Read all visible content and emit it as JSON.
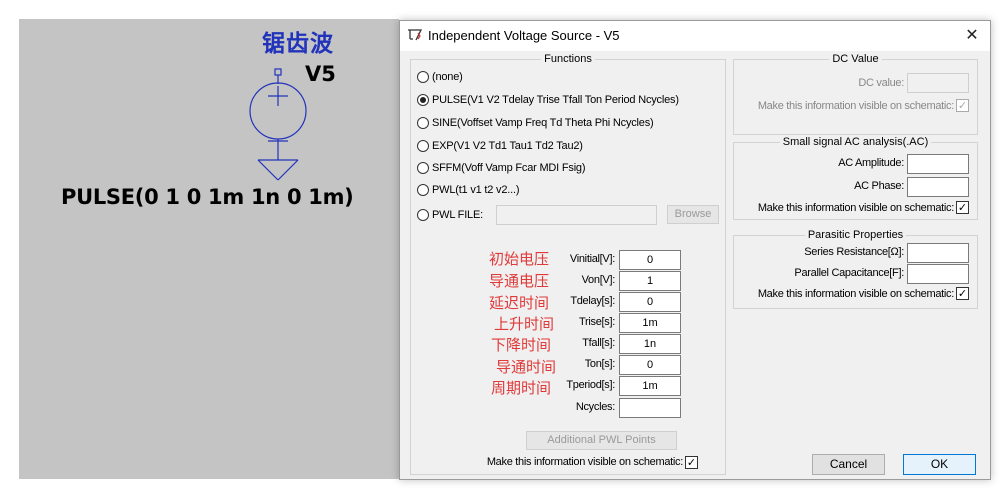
{
  "schematic": {
    "title": "锯齿波",
    "part_name": "V5",
    "source_value": "PULSE(0 1 0 1m 1n 0 1m)",
    "background": "#c4c4c4",
    "title_color": "#2233bb",
    "symbol_color": "#2233bb"
  },
  "dialog": {
    "title": "Independent Voltage Source - V5",
    "close_glyph": "✕",
    "functions": {
      "title": "Functions",
      "options": [
        {
          "label": "(none)",
          "checked": false
        },
        {
          "label": "PULSE(V1 V2 Tdelay Trise Tfall Ton Period Ncycles)",
          "checked": true
        },
        {
          "label": "SINE(Voffset Vamp Freq Td Theta Phi Ncycles)",
          "checked": false
        },
        {
          "label": "EXP(V1 V2 Td1 Tau1 Td2 Tau2)",
          "checked": false
        },
        {
          "label": "SFFM(Voff Vamp Fcar MDI Fsig)",
          "checked": false
        },
        {
          "label": "PWL(t1 v1 t2 v2...)",
          "checked": false
        },
        {
          "label": "PWL FILE:",
          "checked": false
        }
      ],
      "browse_label": "Browse",
      "params": [
        {
          "cn": "初始电压",
          "label": "Vinitial[V]:",
          "value": "0"
        },
        {
          "cn": "导通电压",
          "label": "Von[V]:",
          "value": "1"
        },
        {
          "cn": "延迟时间",
          "label": "Tdelay[s]:",
          "value": "0"
        },
        {
          "cn": "上升时间",
          "label": "Trise[s]:",
          "value": "1m"
        },
        {
          "cn": "下降时间",
          "label": "Tfall[s]:",
          "value": "1n"
        },
        {
          "cn": "导通时间",
          "label": "Ton[s]:",
          "value": "0"
        },
        {
          "cn": "周期时间",
          "label": "Tperiod[s]:",
          "value": "1m"
        },
        {
          "cn": "",
          "label": "Ncycles:",
          "value": ""
        }
      ],
      "additional_pwl_label": "Additional PWL Points",
      "visible_label": "Make this information visible on schematic:",
      "visible_checked": true
    },
    "dc_value": {
      "title": "DC Value",
      "dc_label": "DC value:",
      "dc_value": "",
      "visible_label": "Make this information visible on schematic:",
      "visible_checked": true
    },
    "ac_analysis": {
      "title": "Small signal AC analysis(.AC)",
      "amplitude_label": "AC Amplitude:",
      "amplitude_value": "",
      "phase_label": "AC Phase:",
      "phase_value": "",
      "visible_label": "Make this information visible on schematic:",
      "visible_checked": true
    },
    "parasitic": {
      "title": "Parasitic Properties",
      "series_label": "Series Resistance[Ω]:",
      "series_value": "",
      "parallel_label": "Parallel Capacitance[F]:",
      "parallel_value": "",
      "visible_label": "Make this information visible on schematic:",
      "visible_checked": true
    },
    "cancel_label": "Cancel",
    "ok_label": "OK",
    "check_glyph": "✓",
    "accent_color": "#0078d7",
    "annotation_color": "#e03a3a"
  }
}
